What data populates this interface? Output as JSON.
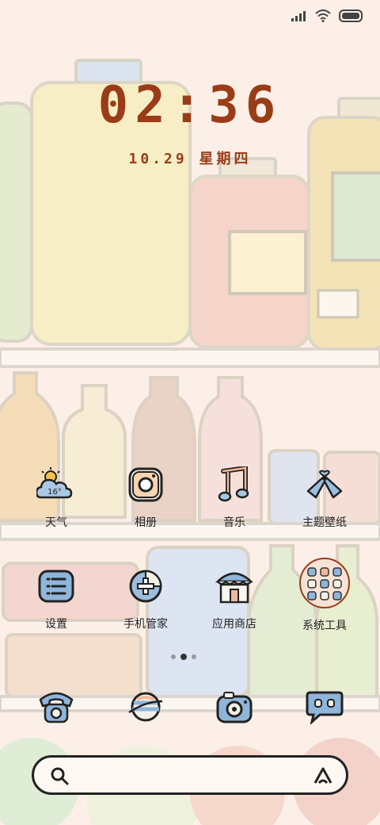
{
  "status_bar": {
    "signal_icon": "signal-bars-icon",
    "wifi_icon": "wifi-icon",
    "battery_icon": "battery-icon"
  },
  "lockclock": {
    "time": "02:36",
    "date": "10.29 星期四"
  },
  "weather": {
    "temp": "16°"
  },
  "apps_row1": [
    {
      "label": "天气",
      "icon": "weather-cloud-icon"
    },
    {
      "label": "相册",
      "icon": "camera-album-icon"
    },
    {
      "label": "音乐",
      "icon": "music-note-icon"
    },
    {
      "label": "主题壁纸",
      "icon": "bow-tie-theme-icon"
    }
  ],
  "apps_row2": [
    {
      "label": "设置",
      "icon": "settings-lines-icon"
    },
    {
      "label": "手机管家",
      "icon": "plus-security-icon"
    },
    {
      "label": "应用商店",
      "icon": "shop-icon"
    },
    {
      "label": "系统工具",
      "icon": "folder-icon"
    }
  ],
  "page_indicator": {
    "pages": 3,
    "current": 2
  },
  "dock": [
    {
      "icon": "phone-icon"
    },
    {
      "icon": "browser-planet-icon"
    },
    {
      "icon": "camera-icon"
    },
    {
      "icon": "message-icon"
    }
  ],
  "search_bar": {
    "search_icon": "search-icon",
    "assistant_icon": "assistant-a-icon"
  },
  "colors": {
    "accent": "#9a3c17",
    "background": "#fbeee6"
  }
}
